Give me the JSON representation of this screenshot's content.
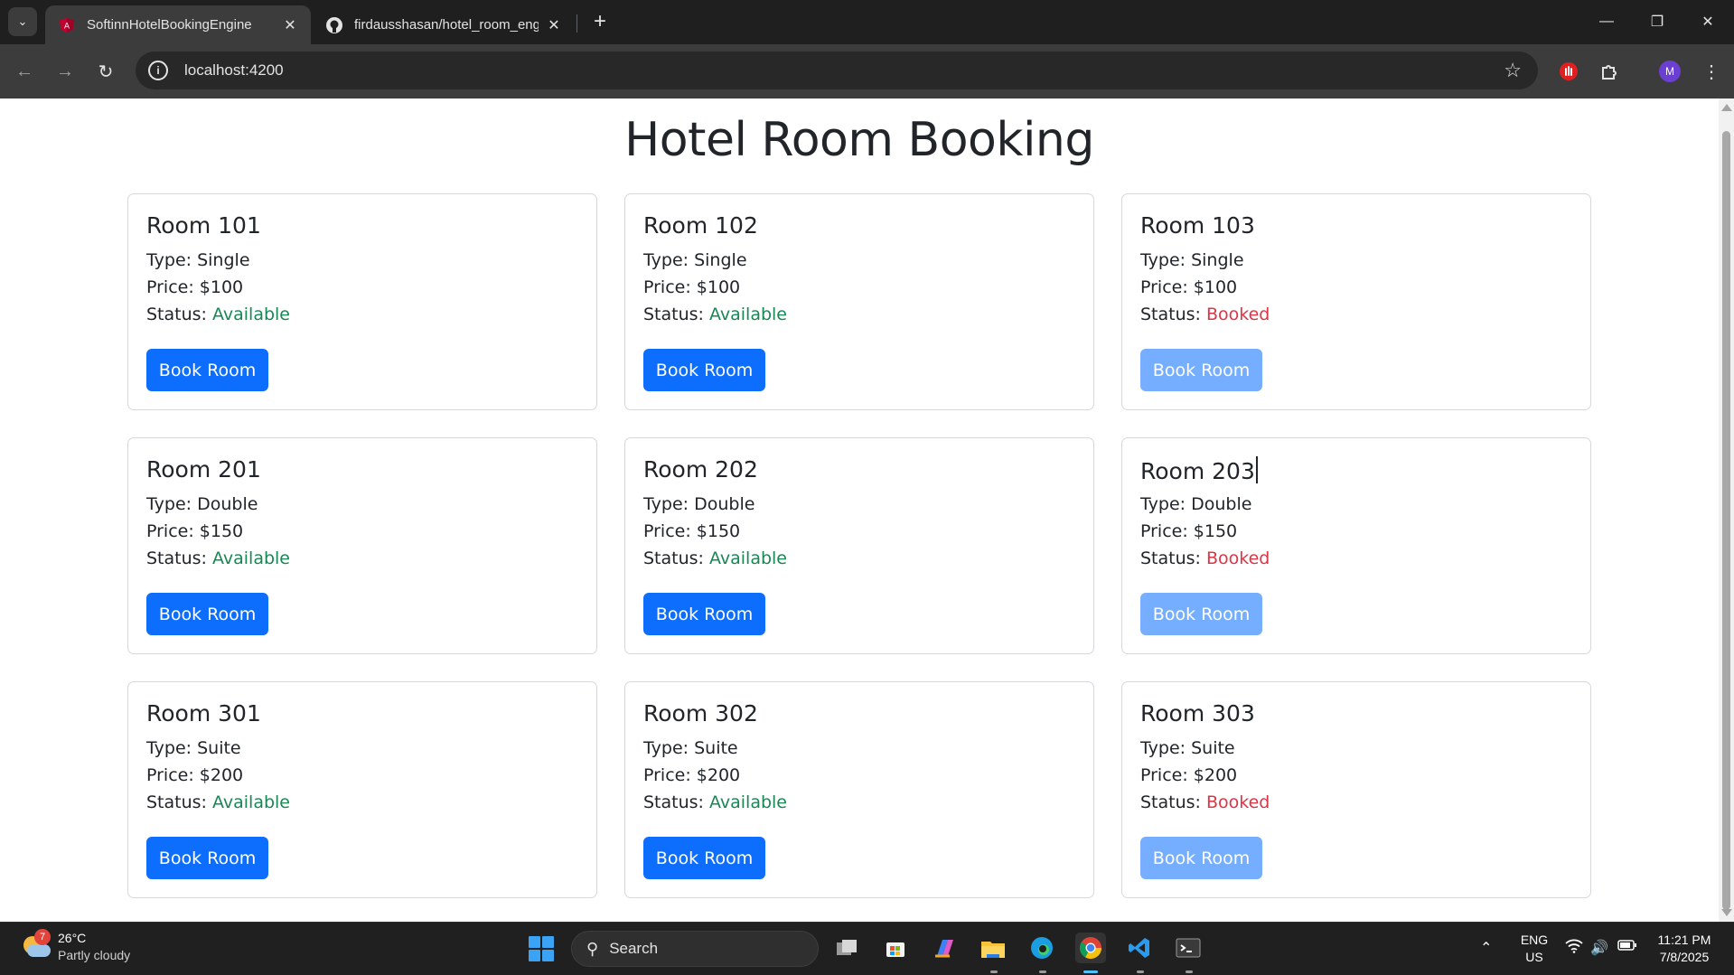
{
  "browser": {
    "tabs": [
      {
        "title": "SoftinnHotelBookingEngine",
        "active": true,
        "favicon": "angular-icon"
      },
      {
        "title": "firdausshasan/hotel_room_engi",
        "active": false,
        "favicon": "github-icon"
      }
    ],
    "url": "localhost:4200",
    "profile_initial": "M"
  },
  "page": {
    "title": "Hotel Room Booking",
    "labels": {
      "type": "Type: ",
      "price": "Price: ",
      "status": "Status: "
    },
    "book_label": "Book Room",
    "rooms": [
      {
        "name": "Room 101",
        "type": "Single",
        "price": "$100",
        "status": "Available"
      },
      {
        "name": "Room 102",
        "type": "Single",
        "price": "$100",
        "status": "Available"
      },
      {
        "name": "Room 103",
        "type": "Single",
        "price": "$100",
        "status": "Booked"
      },
      {
        "name": "Room 201",
        "type": "Double",
        "price": "$150",
        "status": "Available"
      },
      {
        "name": "Room 202",
        "type": "Double",
        "price": "$150",
        "status": "Available"
      },
      {
        "name": "Room 203",
        "type": "Double",
        "price": "$150",
        "status": "Booked"
      },
      {
        "name": "Room 301",
        "type": "Suite",
        "price": "$200",
        "status": "Available"
      },
      {
        "name": "Room 302",
        "type": "Suite",
        "price": "$200",
        "status": "Available"
      },
      {
        "name": "Room 303",
        "type": "Suite",
        "price": "$200",
        "status": "Booked"
      }
    ],
    "colors": {
      "available": "#198754",
      "booked": "#dc3545",
      "primary": "#0d6efd"
    }
  },
  "taskbar": {
    "weather": {
      "temp": "26°C",
      "condition": "Partly cloudy",
      "badge": "7"
    },
    "search_label": "Search",
    "lang": "ENG",
    "region": "US",
    "time": "11:21 PM",
    "date": "7/8/2025"
  }
}
